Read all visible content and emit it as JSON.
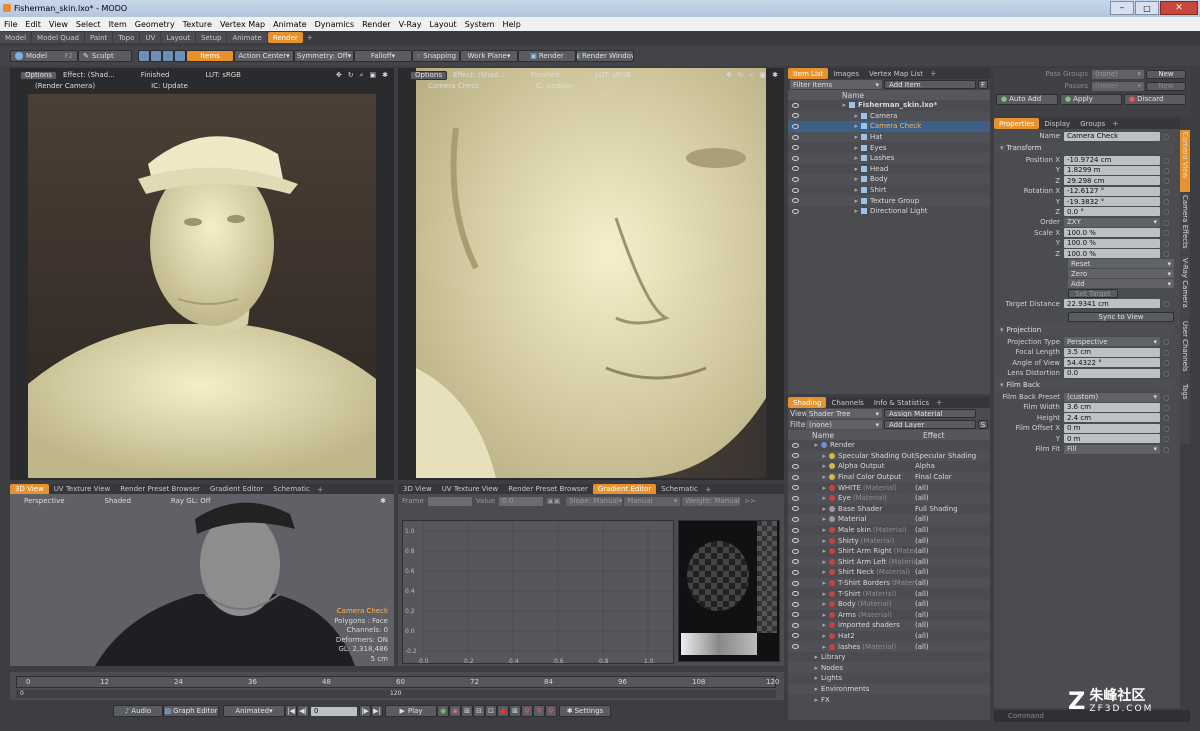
{
  "window": {
    "title": "Fisherman_skin.lxo* - MODO"
  },
  "menu": [
    "File",
    "Edit",
    "View",
    "Select",
    "Item",
    "Geometry",
    "Texture",
    "Vertex Map",
    "Animate",
    "Dynamics",
    "Render",
    "V-Ray",
    "Layout",
    "System",
    "Help"
  ],
  "layout_tabs": [
    "Model",
    "Model Quad",
    "Paint",
    "Topo",
    "UV",
    "Layout",
    "Setup",
    "Animate",
    "Render"
  ],
  "layout_tab_active": "Render",
  "toolbar": {
    "model": "Model",
    "f2": "F2",
    "sculpt": "Sculpt",
    "items": "Items",
    "action_center": "Action Center",
    "symmetry": "Symmetry: Off",
    "falloff": "Falloff",
    "snapping": "Snapping",
    "work_plane": "Work Plane",
    "render": "Render",
    "render_window": "Render Window"
  },
  "render_view": {
    "options": "Options",
    "effect": "Effect: (Shad...",
    "finished": "Finished",
    "lut": "LUT: sRGB",
    "camera": "(Render Camera)",
    "ic": "IC: Update",
    "camera2": "Camera Check"
  },
  "bottom_tabs_left": [
    "3D View",
    "UV Texture View",
    "Render Preset Browser",
    "Gradient Editor",
    "Schematic"
  ],
  "bottom_tabs_mid": [
    "3D View",
    "UV Texture View",
    "Render Preset Browser",
    "Gradient Editor",
    "Schematic"
  ],
  "viewport3d": {
    "perspective": "Perspective",
    "shaded": "Shaded",
    "raygl": "Ray GL: Off",
    "info_title": "Camera Check",
    "info": [
      "Polygons : Face",
      "Channels: 0",
      "Deformers: ON",
      "GL: 2,318,486",
      "5 cm"
    ]
  },
  "gradient": {
    "frame": "Frame",
    "value": "Value",
    "value_num": "0.0",
    "slope1": "Slope: Manual",
    "slope2": "Manual",
    "weight": "Weight: Manual",
    "y_ticks": [
      "1.0",
      "0.8",
      "0.6",
      "0.4",
      "0.2",
      "0.0",
      "-0.2"
    ],
    "x_ticks": [
      "0.0",
      "0.2",
      "0.4",
      "0.6",
      "0.8",
      "1.0"
    ]
  },
  "timeline": {
    "ticks": [
      "0",
      "12",
      "24",
      "36",
      "48",
      "60",
      "72",
      "84",
      "96",
      "108",
      "120"
    ],
    "end": "120",
    "start": "0"
  },
  "transport": {
    "audio": "Audio",
    "graph": "Graph Editor",
    "animated": "Animated",
    "frame": "0",
    "play": "Play",
    "settings": "Settings"
  },
  "item_list": {
    "tabs": [
      "Item List",
      "Images",
      "Vertex Map List"
    ],
    "filter": "Filter Items",
    "add": "Add Item",
    "col_name": "Name",
    "items": [
      {
        "name": "Fisherman_skin.lxo*",
        "indent": 0,
        "bold": true
      },
      {
        "name": "Camera",
        "indent": 2
      },
      {
        "name": "Camera Check",
        "indent": 2,
        "sel": true
      },
      {
        "name": "Hat",
        "indent": 2
      },
      {
        "name": "Eyes",
        "indent": 2
      },
      {
        "name": "Lashes",
        "indent": 2
      },
      {
        "name": "Head",
        "indent": 2
      },
      {
        "name": "Body",
        "indent": 2
      },
      {
        "name": "Shirt",
        "indent": 2
      },
      {
        "name": "Texture Group",
        "indent": 2
      },
      {
        "name": "Directional Light",
        "indent": 2
      }
    ]
  },
  "shading": {
    "tabs": [
      "Shading",
      "Channels",
      "Info & Statistics"
    ],
    "view_lbl": "View",
    "view": "Shader Tree",
    "assign": "Assign Material",
    "filter_lbl": "Filter",
    "filter": "(none)",
    "add_layer": "Add Layer",
    "col_name": "Name",
    "col_effect": "Effect",
    "rows": [
      {
        "name": "Render",
        "tag": "",
        "effect": "",
        "ind": 0,
        "color": "#7a86d8"
      },
      {
        "name": "Specular Shading Output",
        "tag": "",
        "effect": "Specular Shading",
        "ind": 1,
        "color": "#d8b840"
      },
      {
        "name": "Alpha Output",
        "tag": "",
        "effect": "Alpha",
        "ind": 1,
        "color": "#d8b840"
      },
      {
        "name": "Final Color Output",
        "tag": "",
        "effect": "Final Color",
        "ind": 1,
        "color": "#d8b840"
      },
      {
        "name": "WHITE",
        "tag": "(Material)",
        "effect": "(all)",
        "ind": 1,
        "color": "#c84040"
      },
      {
        "name": "Eye",
        "tag": "(Material)",
        "effect": "(all)",
        "ind": 1,
        "color": "#c84040"
      },
      {
        "name": "Base Shader",
        "tag": "",
        "effect": "Full Shading",
        "ind": 1,
        "color": "#9a9a9a"
      },
      {
        "name": "Material",
        "tag": "",
        "effect": "(all)",
        "ind": 1,
        "color": "#9a9a9a"
      },
      {
        "name": "Male skin",
        "tag": "(Material)",
        "effect": "(all)",
        "ind": 1,
        "color": "#c84040"
      },
      {
        "name": "Shirty",
        "tag": "(Material)",
        "effect": "(all)",
        "ind": 1,
        "color": "#c84040"
      },
      {
        "name": "Shirt Arm Right",
        "tag": "(Material)",
        "effect": "(all)",
        "ind": 1,
        "color": "#c84040"
      },
      {
        "name": "Shirt Arm Left",
        "tag": "(Material)",
        "effect": "(all)",
        "ind": 1,
        "color": "#c84040"
      },
      {
        "name": "Shirt Neck",
        "tag": "(Material)",
        "effect": "(all)",
        "ind": 1,
        "color": "#c84040"
      },
      {
        "name": "T-Shirt Borders",
        "tag": "(Material)",
        "effect": "(all)",
        "ind": 1,
        "color": "#c84040"
      },
      {
        "name": "T-Shirt",
        "tag": "(Material)",
        "effect": "(all)",
        "ind": 1,
        "color": "#c84040"
      },
      {
        "name": "Body",
        "tag": "(Material)",
        "effect": "(all)",
        "ind": 1,
        "color": "#c84040"
      },
      {
        "name": "Arms",
        "tag": "(Material)",
        "effect": "(all)",
        "ind": 1,
        "color": "#c84040"
      },
      {
        "name": "imported shaders",
        "tag": "",
        "effect": "(all)",
        "ind": 1,
        "color": "#c84040"
      },
      {
        "name": "Hat2",
        "tag": "",
        "effect": "(all)",
        "ind": 1,
        "color": "#c84040"
      },
      {
        "name": "lashes",
        "tag": "(Material)",
        "effect": "(all)",
        "ind": 1,
        "color": "#c84040"
      },
      {
        "name": "Library",
        "tag": "",
        "effect": "",
        "ind": 0,
        "color": ""
      },
      {
        "name": "Nodes",
        "tag": "",
        "effect": "",
        "ind": 0,
        "color": ""
      },
      {
        "name": "Lights",
        "tag": "",
        "effect": "",
        "ind": 0,
        "color": ""
      },
      {
        "name": "Environments",
        "tag": "",
        "effect": "",
        "ind": 0,
        "color": ""
      },
      {
        "name": "FX",
        "tag": "",
        "effect": "",
        "ind": 0,
        "color": ""
      }
    ]
  },
  "passes": {
    "pass_groups": "Pass Groups",
    "passes": "Passes",
    "none": "(none)",
    "new": "New",
    "auto_add": "Auto Add",
    "apply": "Apply",
    "discard": "Discard"
  },
  "props": {
    "tabs": [
      "Properties",
      "Display",
      "Groups"
    ],
    "name_lbl": "Name",
    "name": "Camera Check",
    "transform": "Transform",
    "pos_lbl": "Position X",
    "pos": [
      "-10.9724 cm",
      "1.8299 m",
      "29.298 cm"
    ],
    "rot_lbl": "Rotation X",
    "rot": [
      "-12.6127 °",
      "-19.3832 °",
      "0.0 °"
    ],
    "order_lbl": "Order",
    "order": "ZXY",
    "scale_lbl": "Scale X",
    "scale": [
      "100.0 %",
      "100.0 %",
      "100.0 %"
    ],
    "reset": "Reset",
    "zero": "Zero",
    "add": "Add",
    "set_target": "Set Target",
    "target_lbl": "Target Distance",
    "target": "22.9341 cm",
    "sync": "Sync to View",
    "projection": "Projection",
    "proj_type_lbl": "Projection Type",
    "proj_type": "Perspective",
    "focal_lbl": "Focal Length",
    "focal": "3.5 cm",
    "aov_lbl": "Angle of View",
    "aov": "54.4322 °",
    "distort_lbl": "Lens Distortion",
    "distort": "0.0",
    "film_back": "Film Back",
    "fb_preset_lbl": "Film Back Preset",
    "fb_preset": "(custom)",
    "fw_lbl": "Film Width",
    "fw": "3.6 cm",
    "fh_lbl": "Height",
    "fh": "2.4 cm",
    "fo_lbl": "Film Offset X",
    "fo": "0 m",
    "foy": "0 m",
    "fit_lbl": "Film Fit",
    "fit": "Fill",
    "y": "Y",
    "z": "Z",
    "side_tabs": [
      "Camera View",
      "Camera Effects",
      "V-Ray Camera",
      "User Channels",
      "Tags"
    ]
  },
  "command": "Command",
  "watermark": {
    "cn": "朱峰社区",
    "url": "ZF3D.COM"
  }
}
